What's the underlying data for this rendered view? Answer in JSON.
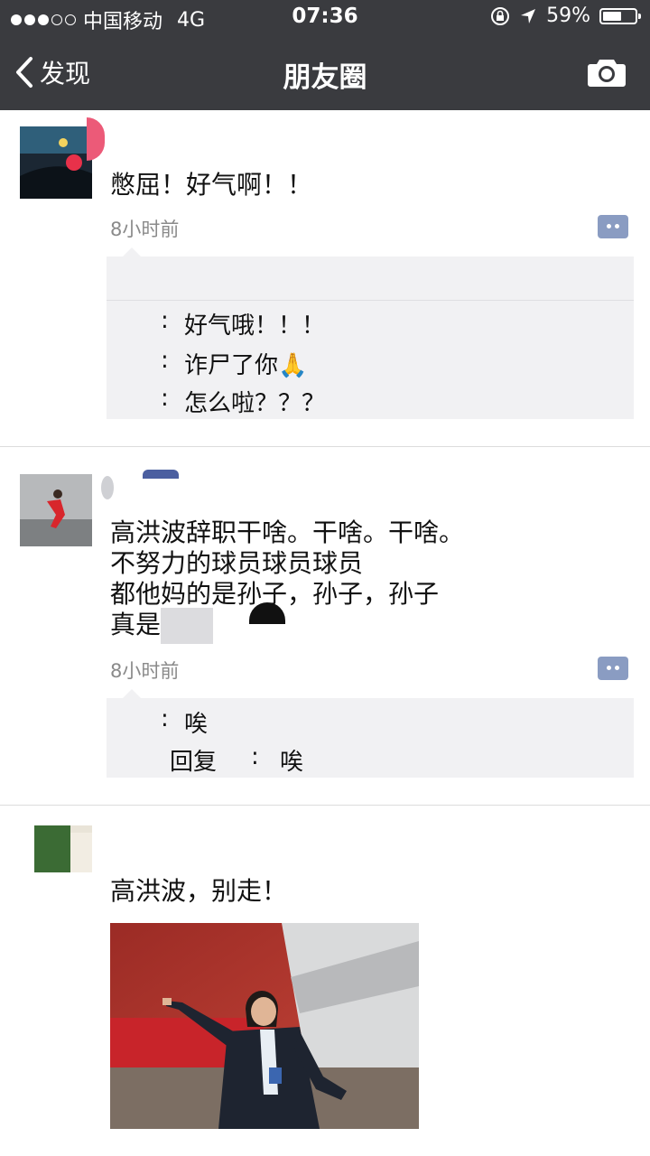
{
  "status_bar": {
    "carrier": "中国移动",
    "network": "4G",
    "time": "07:36",
    "battery": "59%",
    "battery_level": 0.59
  },
  "nav": {
    "back_label": "发现",
    "title": "朋友圈"
  },
  "posts": [
    {
      "text": "憋屈！好气啊！！",
      "time": "8小时前",
      "comments": [
        {
          "sep": ": ",
          "text": "好气哦！！！"
        },
        {
          "sep": ": ",
          "text": "诈尸了你🙏"
        },
        {
          "sep": ": ",
          "text": "怎么啦？？？"
        }
      ]
    },
    {
      "text": "高洪波辞职干啥。干啥。干啥。\n不努力的球员球员球员\n都他妈的是孙子，孙子，孙子\n真是",
      "time": "8小时前",
      "comments": [
        {
          "sep": ": ",
          "text": "唉"
        },
        {
          "reply": "回复",
          "sep": ": ",
          "text": "唉"
        }
      ]
    },
    {
      "text": "高洪波，别走！"
    }
  ]
}
